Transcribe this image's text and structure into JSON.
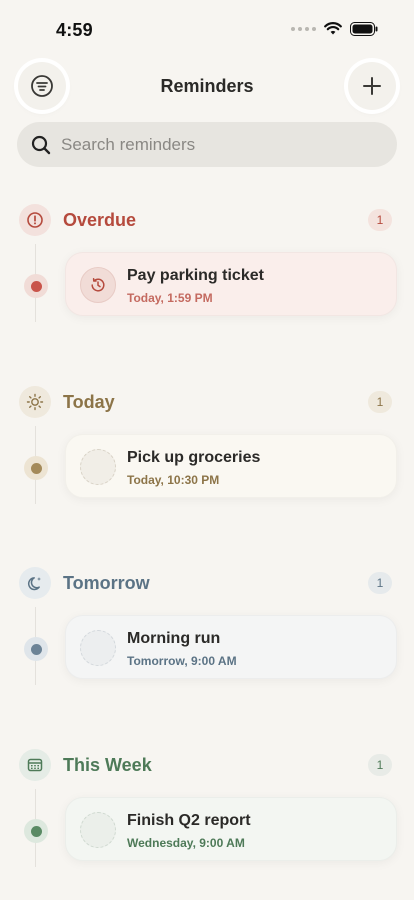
{
  "status_bar": {
    "time": "4:59"
  },
  "header": {
    "title": "Reminders",
    "filter_icon": "filter-icon",
    "add_icon": "plus-icon"
  },
  "search": {
    "placeholder": "Search reminders",
    "icon": "search-icon"
  },
  "colors": {
    "overdue": "#b54a3d",
    "today": "#8c7448",
    "tomorrow": "#5b7385",
    "this_week": "#4e7a58"
  },
  "sections": [
    {
      "title": "Overdue",
      "count": "1",
      "icon": "alert-circle-icon",
      "items": [
        {
          "title": "Pay parking ticket",
          "time": "Today, 1:59 PM",
          "icon": "history-icon"
        }
      ]
    },
    {
      "title": "Today",
      "count": "1",
      "icon": "sun-icon",
      "items": [
        {
          "title": "Pick up groceries",
          "time": "Today, 10:30 PM"
        }
      ]
    },
    {
      "title": "Tomorrow",
      "count": "1",
      "icon": "moon-icon",
      "items": [
        {
          "title": "Morning run",
          "time": "Tomorrow, 9:00 AM"
        }
      ]
    },
    {
      "title": "This Week",
      "count": "1",
      "icon": "calendar-icon",
      "items": [
        {
          "title": "Finish Q2 report",
          "time": "Wednesday, 9:00 AM"
        }
      ]
    }
  ]
}
